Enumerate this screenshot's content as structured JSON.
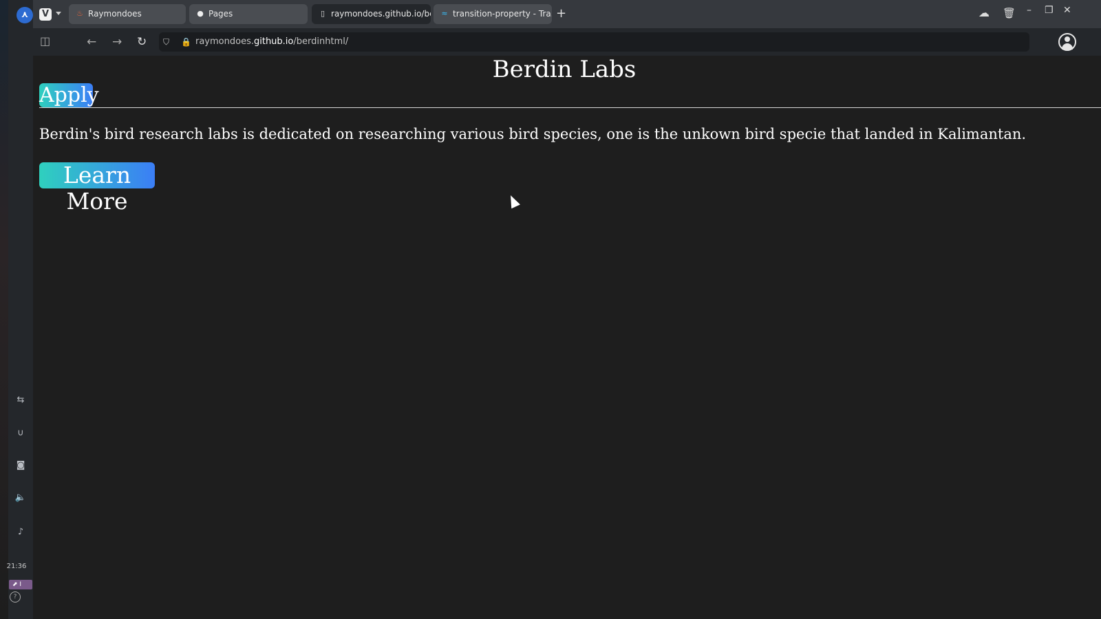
{
  "system_panel": {
    "clock": "21:36",
    "tray_text": "⬈ I"
  },
  "browser": {
    "tabs": [
      {
        "label": "Raymondoes",
        "icon": "flame-icon",
        "active": false
      },
      {
        "label": "Pages",
        "icon": "github-icon",
        "active": false
      },
      {
        "label": "raymondoes.github.io/berd",
        "icon": "page-icon",
        "active": true
      },
      {
        "label": "transition-property - Tra...",
        "icon": "tailwind-icon",
        "active": false
      }
    ],
    "new_tab_label": "+",
    "url": {
      "prefix": "raymondoes.",
      "host": "github.io",
      "path": "/berdinhtml/"
    }
  },
  "page": {
    "title": "Berdin Labs",
    "apply_label": "Apply",
    "intro": "Berdin's bird research labs is dedicated on researching various bird species, one is the unkown bird specie that landed in Kalimantan.",
    "learn_more_label": "Learn More"
  },
  "colors": {
    "page_background": "#1e1e1e",
    "tab_bar": "#36393e",
    "button_gradient_start": "#2fd0be",
    "button_gradient_end": "#3b7ef6"
  }
}
